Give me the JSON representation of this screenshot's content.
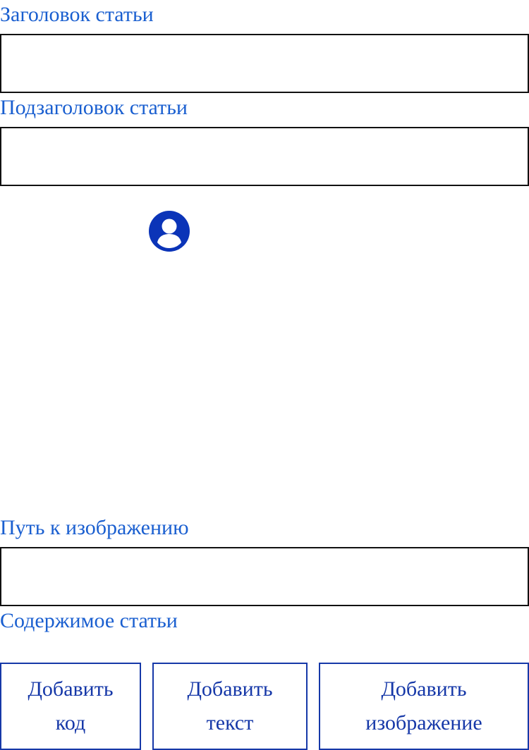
{
  "form": {
    "title_label": "Заголовок статьи",
    "title_value": "",
    "subtitle_label": "Подзаголовок статьи",
    "subtitle_value": "",
    "image_path_label": "Путь к изображению",
    "image_path_value": "",
    "content_label": "Содержимое статьи"
  },
  "avatar": {
    "icon": "user-circle-icon",
    "color": "#0b34b8"
  },
  "buttons": {
    "add_code": "Добавить\nкод",
    "add_text": "Добавить\nтекст",
    "add_image": "Добавить\nизображение"
  },
  "colors": {
    "label": "#1a5fd0",
    "button": "#1638a8",
    "border": "#111111"
  }
}
